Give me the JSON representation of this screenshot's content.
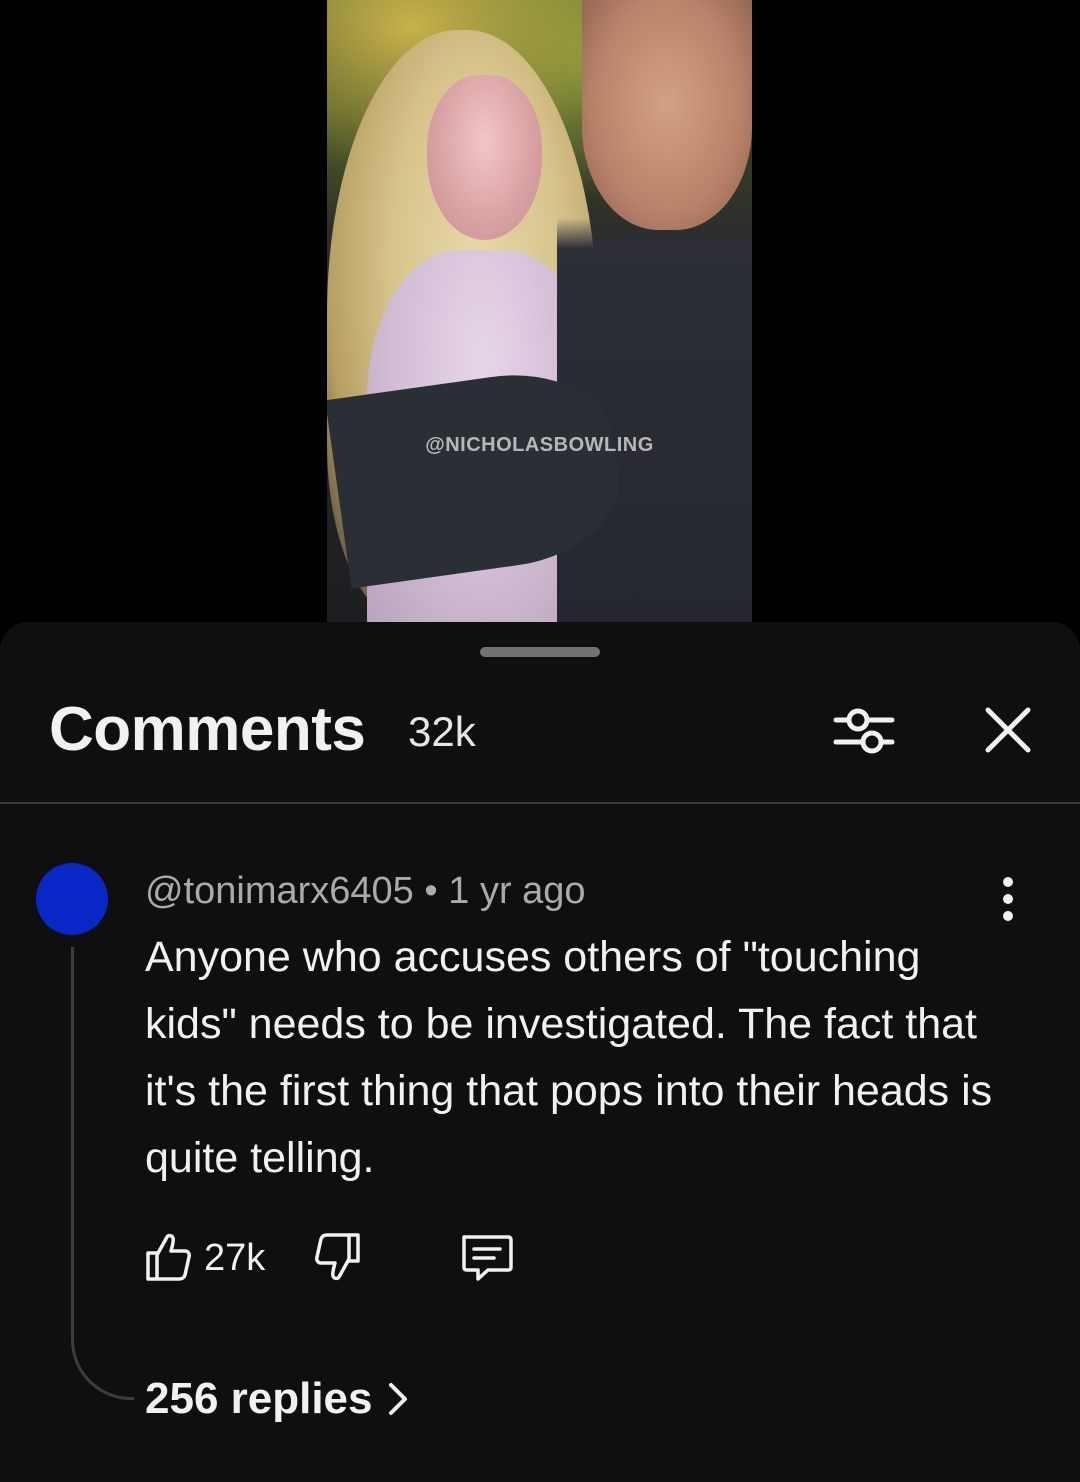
{
  "video": {
    "watermark": "@NICHOLASBOWLING"
  },
  "comments_panel": {
    "title": "Comments",
    "count": "32k",
    "filter_icon": "sliders-icon",
    "close_icon": "close-icon"
  },
  "comment": {
    "author": "@tonimarx6405",
    "separator": " • ",
    "time": "1 yr ago",
    "text": "Anyone who accuses others of \"touching kids\" needs to be investigated. The fact that it's the first thing that pops into their heads is quite telling.",
    "likes": "27k",
    "avatar_color": "#0a28c8",
    "replies_label": "256 replies"
  },
  "colors": {
    "sheet_background": "#0f0f0f",
    "primary_text": "#f1f1f1",
    "secondary_text": "#aaaaaa",
    "divider": "#3a3a3a"
  }
}
